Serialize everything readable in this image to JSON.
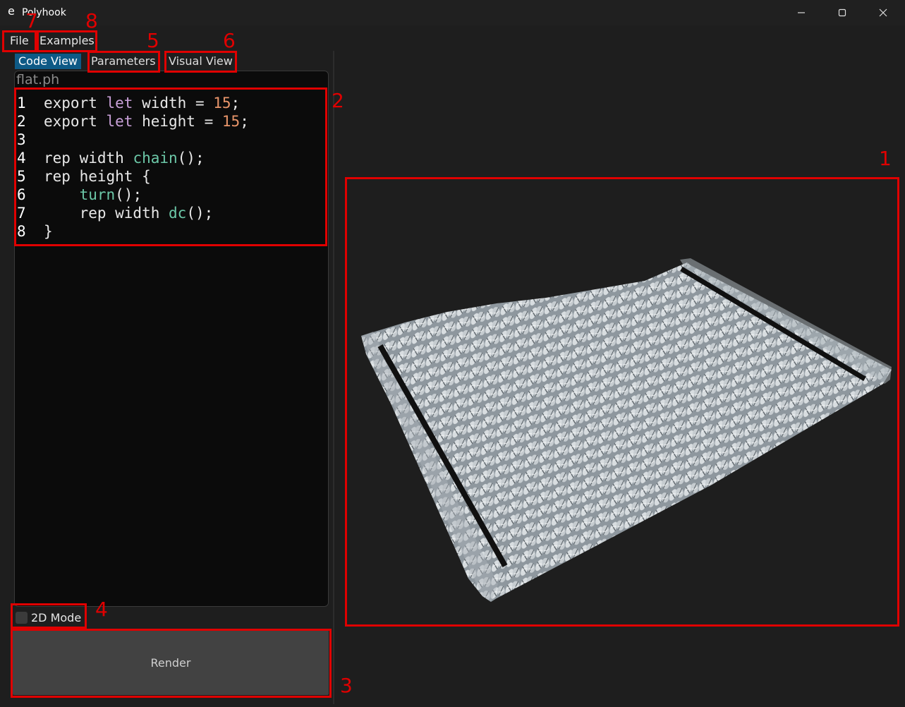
{
  "window": {
    "icon": "e",
    "title": "Polyhook"
  },
  "menu": {
    "file": "File",
    "examples": "Examples"
  },
  "tabs": {
    "code_view": "Code View",
    "parameters": "Parameters",
    "visual_view": "Visual View"
  },
  "editor": {
    "filename": "flat.ph",
    "lines": [
      {
        "n": "1",
        "tokens": [
          {
            "t": "export ",
            "c": ""
          },
          {
            "t": "let",
            "c": "kw"
          },
          {
            "t": " width = ",
            "c": ""
          },
          {
            "t": "15",
            "c": "num"
          },
          {
            "t": ";",
            "c": ""
          }
        ]
      },
      {
        "n": "2",
        "tokens": [
          {
            "t": "export ",
            "c": ""
          },
          {
            "t": "let",
            "c": "kw"
          },
          {
            "t": " height = ",
            "c": ""
          },
          {
            "t": "15",
            "c": "num"
          },
          {
            "t": ";",
            "c": ""
          }
        ]
      },
      {
        "n": "3",
        "tokens": []
      },
      {
        "n": "4",
        "tokens": [
          {
            "t": "rep width ",
            "c": ""
          },
          {
            "t": "chain",
            "c": "fn"
          },
          {
            "t": "();",
            "c": ""
          }
        ]
      },
      {
        "n": "5",
        "tokens": [
          {
            "t": "rep height {",
            "c": ""
          }
        ]
      },
      {
        "n": "6",
        "tokens": [
          {
            "t": "    ",
            "c": ""
          },
          {
            "t": "turn",
            "c": "fn"
          },
          {
            "t": "();",
            "c": ""
          }
        ]
      },
      {
        "n": "7",
        "tokens": [
          {
            "t": "    rep width ",
            "c": ""
          },
          {
            "t": "dc",
            "c": "fn"
          },
          {
            "t": "();",
            "c": ""
          }
        ]
      },
      {
        "n": "8",
        "tokens": [
          {
            "t": "}",
            "c": ""
          }
        ]
      }
    ]
  },
  "mode_toggle": {
    "label": "2D Mode",
    "checked": false
  },
  "render_button": {
    "label": "Render"
  },
  "annotations": {
    "n1": "1",
    "n2": "2",
    "n3": "3",
    "n4": "4",
    "n5": "5",
    "n6": "6",
    "n7": "7",
    "n8": "8"
  },
  "colors": {
    "annotation": "#e00000",
    "active_tab": "#0e5a86",
    "background": "#1e1e1e"
  }
}
